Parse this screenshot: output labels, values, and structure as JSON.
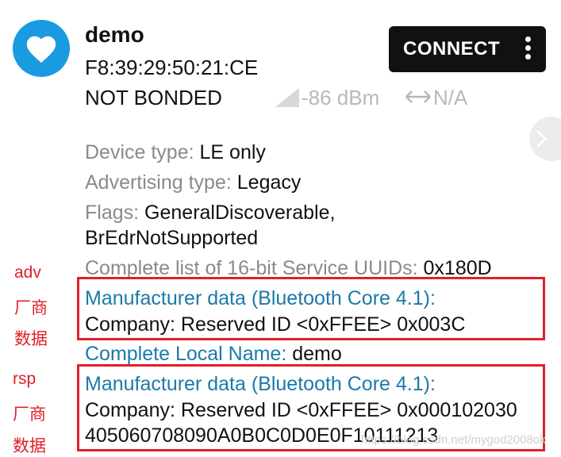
{
  "device": {
    "name": "demo",
    "address": "F8:39:29:50:21:CE",
    "bond_state": "NOT BONDED",
    "rssi": "-86 dBm",
    "interval": "N/A",
    "avatar_icon": "heart-icon",
    "avatar_color": "#1a9ae0"
  },
  "actions": {
    "connect_label": "CONNECT",
    "more_icon": "more-vert-icon",
    "side_icon": "chevron-right-icon"
  },
  "details": {
    "device_type_label": "Device type: ",
    "device_type_value": "LE only",
    "adv_type_label": "Advertising type: ",
    "adv_type_value": "Legacy",
    "flags_label": "Flags: ",
    "flags_value_1": "GeneralDiscoverable,",
    "flags_value_2": "BrEdrNotSupported",
    "uuids_label": "Complete list of 16-bit Service UUIDs: ",
    "uuids_value": "0x180D",
    "mfr1_label": "Manufacturer data (Bluetooth Core 4.1):",
    "mfr1_value": "Company: Reserved ID <0xFFEE> 0x003C",
    "local_name_label": "Complete Local Name: ",
    "local_name_value": "demo",
    "mfr2_label": "Manufacturer data (Bluetooth Core 4.1):",
    "mfr2_value_1": "Company: Reserved ID <0xFFEE> 0x000102030",
    "mfr2_value_2": "405060708090A0B0C0D0E0F10111213"
  },
  "annotations": {
    "adv_1": "adv",
    "adv_2": "厂商",
    "adv_3": "数据",
    "rsp_1": "rsp",
    "rsp_2": "厂商",
    "rsp_3": "数据",
    "color": "#e0202a"
  },
  "watermark": "https://blog.csdn.net/mygod2008ok"
}
